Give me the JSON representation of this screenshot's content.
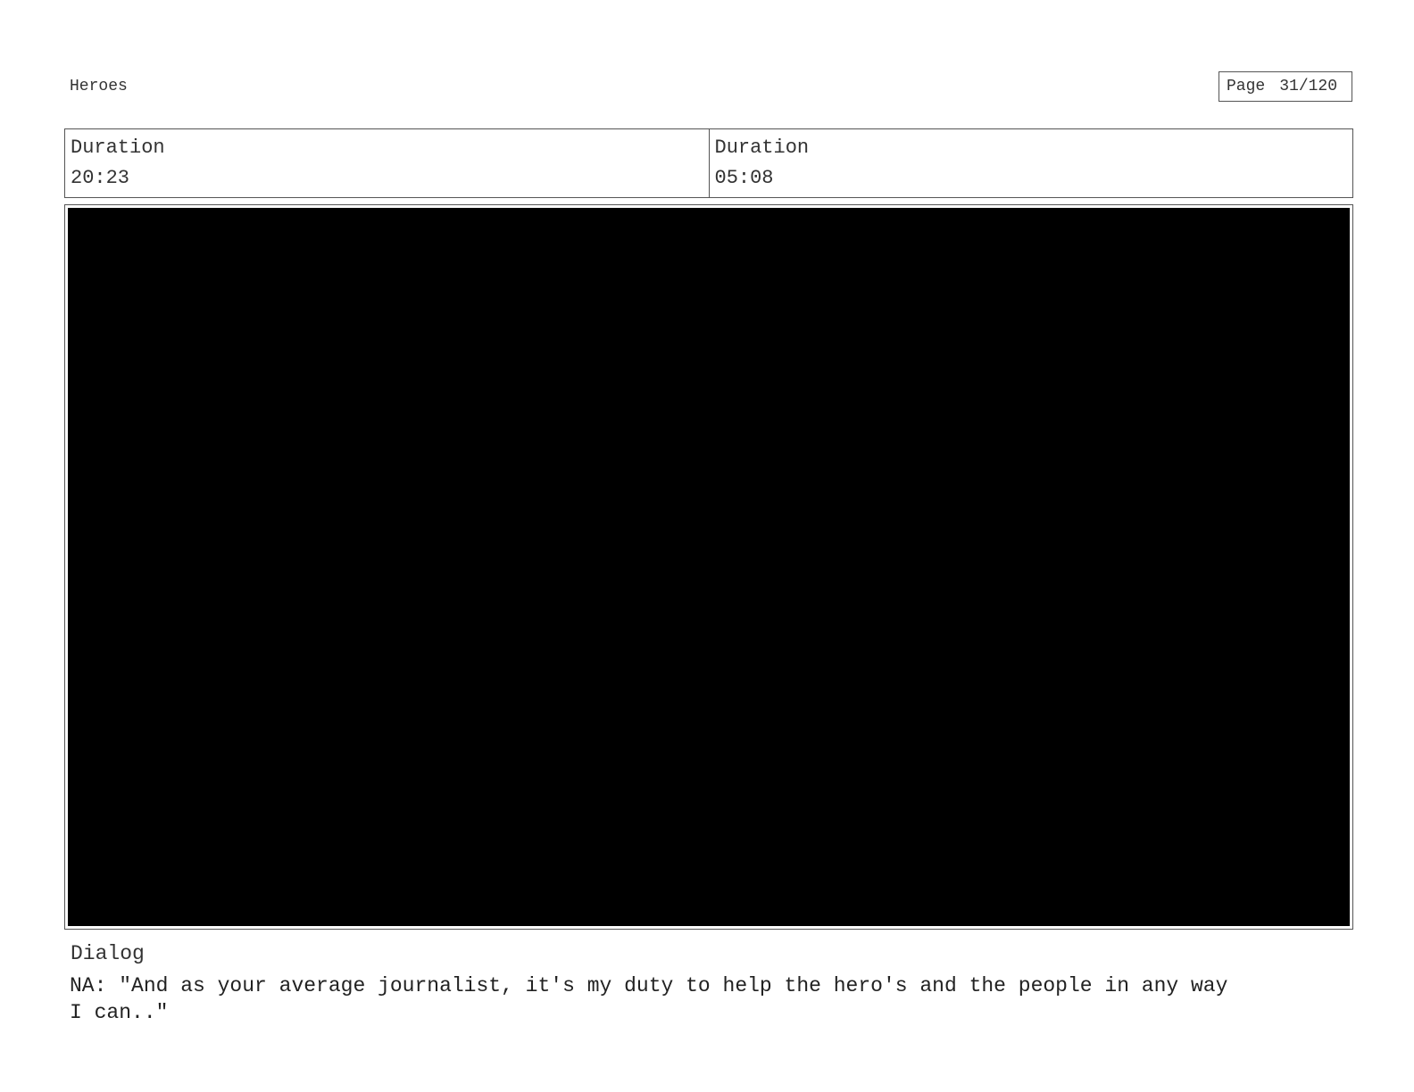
{
  "header": {
    "project_title": "Heroes",
    "page_label": "Page",
    "page_number": "31/120"
  },
  "shot": {
    "durations": [
      {
        "label": "Duration",
        "value": "20:23"
      },
      {
        "label": "Duration",
        "value": "05:08"
      }
    ]
  },
  "frame": {
    "fill_color": "#000000"
  },
  "dialog": {
    "label": "Dialog",
    "text": "NA: \"And as your average journalist, it's my duty to help the hero's and the people in any way\nI can..\""
  }
}
